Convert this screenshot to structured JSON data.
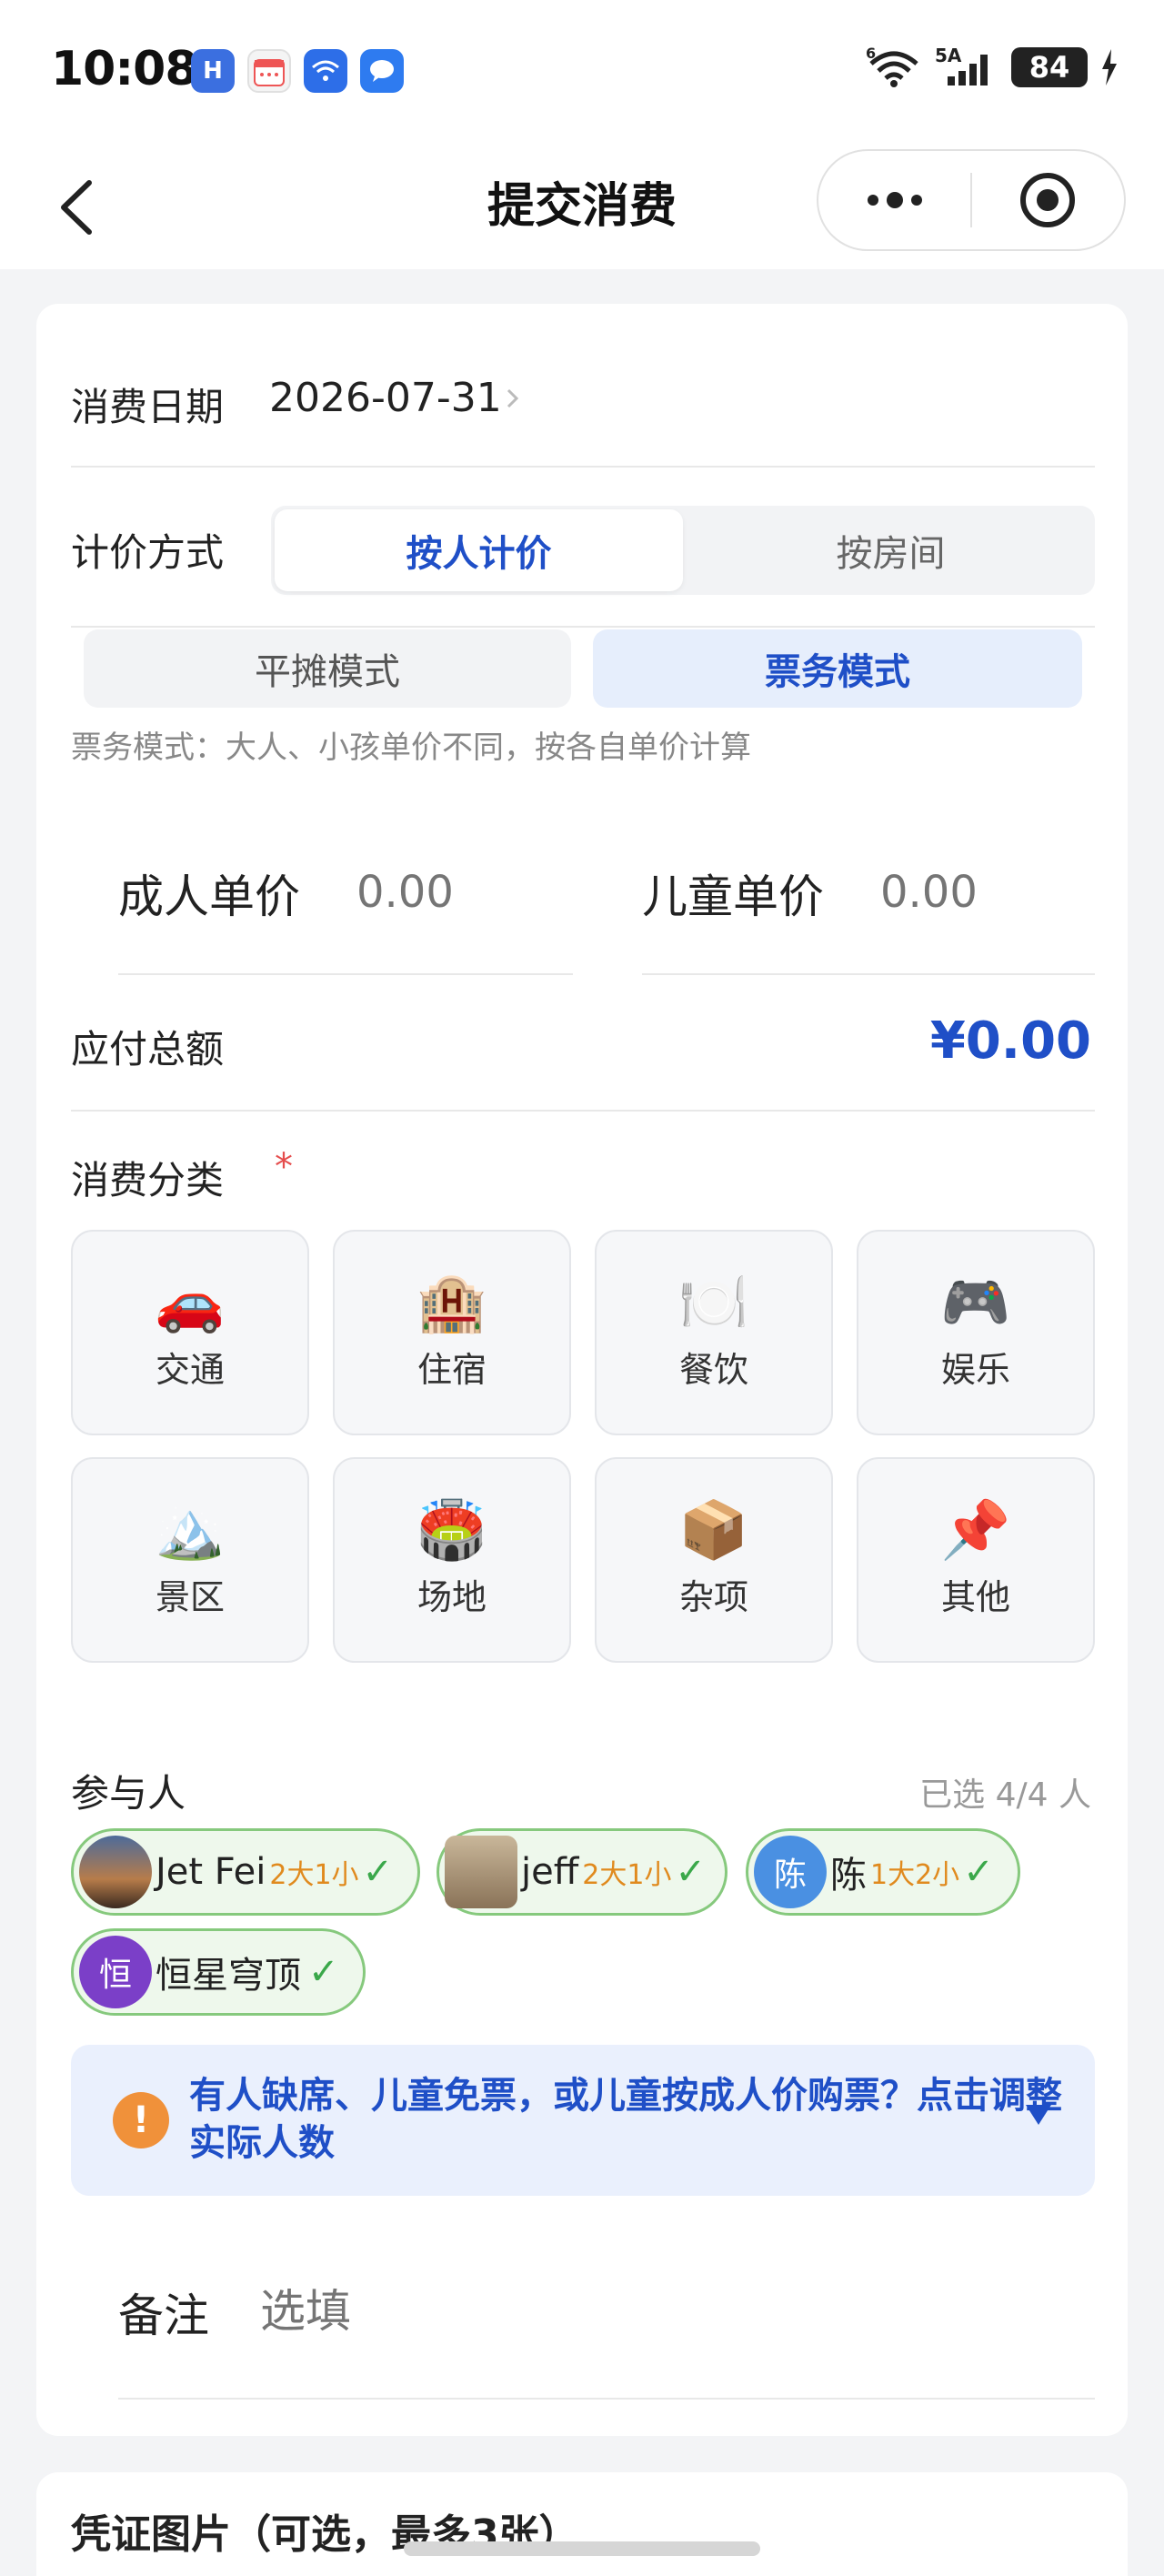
{
  "status_bar": {
    "time": "10:08",
    "battery": "84",
    "signal_text": "5A",
    "wifi_text": "6",
    "app_icons": [
      "app-h-icon",
      "calendar-icon",
      "wifi-app-icon",
      "message-icon"
    ]
  },
  "nav": {
    "title": "提交消费"
  },
  "form": {
    "date_label": "消费日期",
    "date_value": "2026-07-31",
    "pricing_label": "计价方式",
    "pricing_options": [
      "按人计价",
      "按房间"
    ],
    "pricing_selected": 0,
    "mode_options": [
      "平摊模式",
      "票务模式"
    ],
    "mode_selected": 1,
    "mode_hint": "票务模式：大人、小孩单价不同，按各自单价计算",
    "adult_price_label": "成人单价",
    "adult_price_placeholder": "0.00",
    "child_price_label": "儿童单价",
    "child_price_placeholder": "0.00",
    "total_label": "应付总额",
    "total_value": "¥0.00",
    "category_label": "消费分类",
    "required_mark": "*",
    "categories": [
      {
        "label": "交通",
        "emoji": "🚗"
      },
      {
        "label": "住宿",
        "emoji": "🏨"
      },
      {
        "label": "餐饮",
        "emoji": "🍽️"
      },
      {
        "label": "娱乐",
        "emoji": "🎮"
      },
      {
        "label": "景区",
        "emoji": "🏔️"
      },
      {
        "label": "场地",
        "emoji": "🏟️"
      },
      {
        "label": "杂项",
        "emoji": "📦"
      },
      {
        "label": "其他",
        "emoji": "📌"
      }
    ],
    "participants_label": "参与人",
    "participants_count": "已选 4/4 人",
    "participants": [
      {
        "name": "Jet Fei",
        "count": "2大1小",
        "avatar_text": "",
        "check": "✓"
      },
      {
        "name": "jeff",
        "count": "2大1小",
        "avatar_text": "",
        "check": "✓"
      },
      {
        "name": "陈",
        "count": "1大2小",
        "avatar_text": "陈",
        "check": "✓"
      },
      {
        "name": "恒星穹顶",
        "count": "",
        "avatar_text": "恒",
        "check": "✓"
      }
    ],
    "notice_icon": "!",
    "notice_text": "有人缺席、儿童免票，或儿童按成人价购票？点击调整实际人数",
    "remark_label": "备注",
    "remark_placeholder": "选填"
  },
  "voucher": {
    "title": "凭证图片（可选，最多3张）"
  },
  "colors": {
    "accent": "#1f4fc7",
    "chip_border": "#86c97d",
    "chip_bg": "#eef8ec",
    "count_orange": "#e08a1e",
    "notice_bg": "#eaf0fd",
    "required_red": "#e54d4d"
  }
}
